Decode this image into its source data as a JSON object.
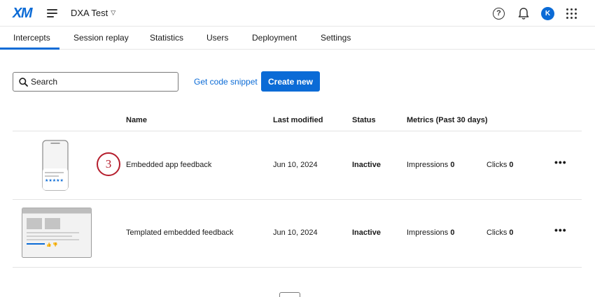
{
  "header": {
    "logo": "XM",
    "project": "DXA Test",
    "avatar_initial": "K"
  },
  "tabs": [
    {
      "label": "Intercepts",
      "active": true
    },
    {
      "label": "Session replay"
    },
    {
      "label": "Statistics"
    },
    {
      "label": "Users"
    },
    {
      "label": "Deployment"
    },
    {
      "label": "Settings"
    }
  ],
  "toolbar": {
    "search_placeholder": "Search",
    "snippet_label": "Get code snippet",
    "create_label": "Create new"
  },
  "table": {
    "columns": [
      "Name",
      "Last modified",
      "Status",
      "Metrics (Past 30 days)"
    ],
    "rows": [
      {
        "name": "Embedded app feedback",
        "modified": "Jun 10, 2024",
        "status": "Inactive",
        "impressions_label": "Impressions",
        "impressions": "0",
        "clicks_label": "Clicks",
        "clicks": "0"
      },
      {
        "name": "Templated embedded feedback",
        "modified": "Jun 10, 2024",
        "status": "Inactive",
        "impressions_label": "Impressions",
        "impressions": "0",
        "clicks_label": "Clicks",
        "clicks": "0"
      }
    ]
  },
  "step_badge": "3",
  "colors": {
    "accent": "#0b6bd6",
    "badge": "#b51d2c"
  },
  "icons": [
    "menu-icon",
    "chevron-down-icon",
    "help-icon",
    "bell-icon",
    "apps-grid-icon",
    "search-icon",
    "more-icon"
  ]
}
